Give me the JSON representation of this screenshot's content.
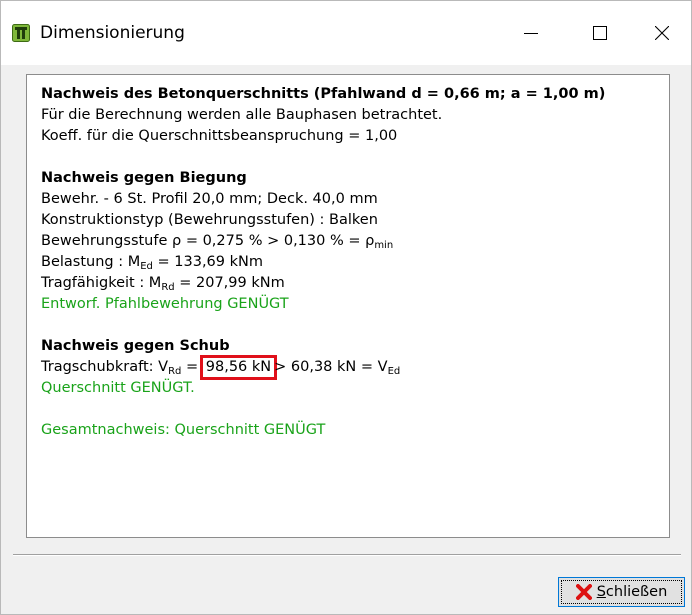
{
  "window": {
    "title": "Dimensionierung",
    "controls": {
      "minimize": "minimize",
      "maximize": "maximize",
      "close": "close"
    }
  },
  "report": {
    "section1": {
      "heading": "Nachweis des Betonquerschnitts (Pfahlwand d = 0,66 m; a = 1,00 m)",
      "line1": "Für die Berechnung werden alle Bauphasen betrachtet.",
      "line2": "Koeff. für die Querschnittsbeanspruchung = 1,00"
    },
    "section2": {
      "heading": "Nachweis gegen Biegung",
      "reinforcement": "Bewehr. - 6 St. Profil 20,0 mm; Deck. 40,0 mm",
      "construction_type": "Konstruktionstyp (Bewehrungsstufen) : Balken",
      "ratio_prefix": "Bewehrungsstufe ρ = 0,275 % > 0,130 % = ρ",
      "ratio_sub": "min",
      "load_prefix": "Belastung : M",
      "load_sub": "Ed",
      "load_value": " = 133,69 kNm",
      "capacity_prefix": "Tragfähigkeit : M",
      "capacity_sub": "Rd",
      "capacity_value": " = 207,99 kNm",
      "result": "Entworf. Pfahlbewehrung GENÜGT"
    },
    "section3": {
      "heading": "Nachweis gegen Schub",
      "shear_prefix": "Tragschubkraft: V",
      "shear_sub_rd": "Rd",
      "shear_eq": " =",
      "shear_highlight": "98,56 kN",
      "shear_rest": "> 60,38 kN = V",
      "shear_sub_ed": "Ed",
      "result": "Querschnitt GENÜGT."
    },
    "summary": "Gesamtnachweis: Querschnitt GENÜGT"
  },
  "buttons": {
    "close_label": "Schließen",
    "close_icon": "red-x-icon"
  },
  "colors": {
    "ok_green": "#1aa31a",
    "highlight_red": "#e0101a",
    "focus_blue": "#0078d7"
  }
}
